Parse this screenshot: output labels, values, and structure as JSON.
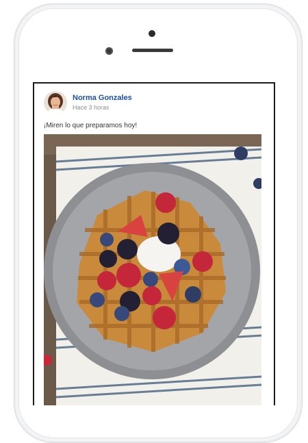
{
  "post": {
    "author": "Norma Gonzales",
    "time": "Hace 3 horas",
    "caption": "¡Miren lo que preparamos hoy!"
  },
  "icons": {
    "avatar": "profile-photo",
    "photo": "waffle-with-berries"
  },
  "colors": {
    "author_link": "#1e4fa3",
    "timestamp": "#8a8f96",
    "phone_frame": "#f3f4f5"
  }
}
